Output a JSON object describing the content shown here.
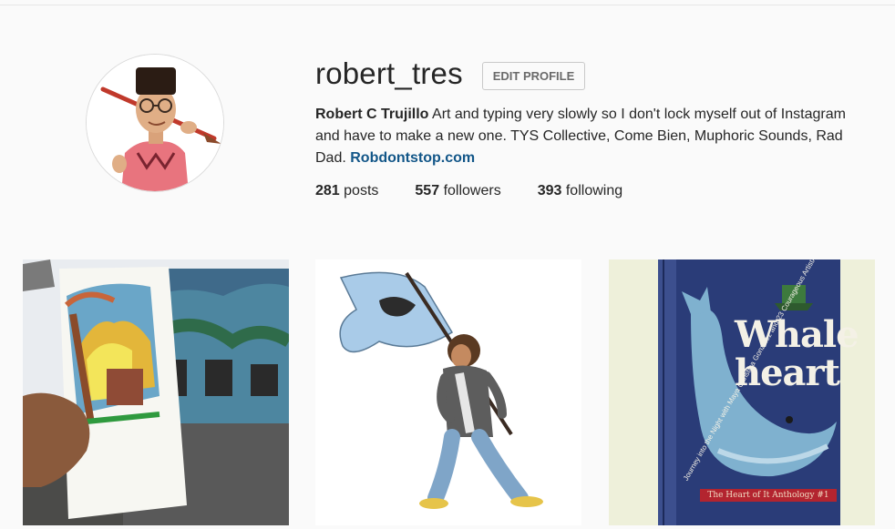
{
  "profile": {
    "username": "robert_tres",
    "edit_button": "EDIT PROFILE",
    "full_name": "Robert C Trujillo",
    "bio": " Art and typing very slowly so I don't lock myself out of Instagram and have to make a new one. TYS Collective, Come Bien, Muphoric Sounds, Rad Dad. ",
    "website": "Robdontstop.com"
  },
  "stats": {
    "posts_count": "281",
    "posts_label": "posts",
    "followers_count": "557",
    "followers_label": "followers",
    "following_count": "393",
    "following_label": "following"
  },
  "posts": {
    "third_title_line1": "Whale",
    "third_title_line2": "heart",
    "third_subtitle": "Journey into the Night with Maya Christina Gonzalez and 23 Courageous ArtistAuthors",
    "third_footer": "The Heart of It Anthology #1"
  },
  "colors": {
    "link": "#125688",
    "text": "#262626",
    "background": "#fafafa"
  }
}
